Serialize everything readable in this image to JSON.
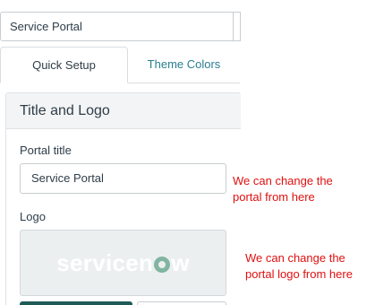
{
  "top_field": {
    "value": "Service Portal"
  },
  "tabs": [
    {
      "label": "Quick Setup",
      "active": true
    },
    {
      "label": "Theme Colors",
      "active": false
    }
  ],
  "panel": {
    "title": "Title and Logo",
    "portal_title_label": "Portal title",
    "portal_title_value": "Service Portal",
    "logo_label": "Logo",
    "logo_alt": "servicenow"
  },
  "annotations": {
    "title_note_line1": "We can change the",
    "title_note_line2": "portal from here",
    "logo_note_line1": "We can change the",
    "logo_note_line2": "portal logo from here"
  },
  "colors": {
    "annotation": "#e01010",
    "tab_inactive": "#2a7f8f",
    "logo_bg": "#eceff0",
    "logo_accent": "#81b5a1",
    "primary_button": "#1f5b56"
  }
}
